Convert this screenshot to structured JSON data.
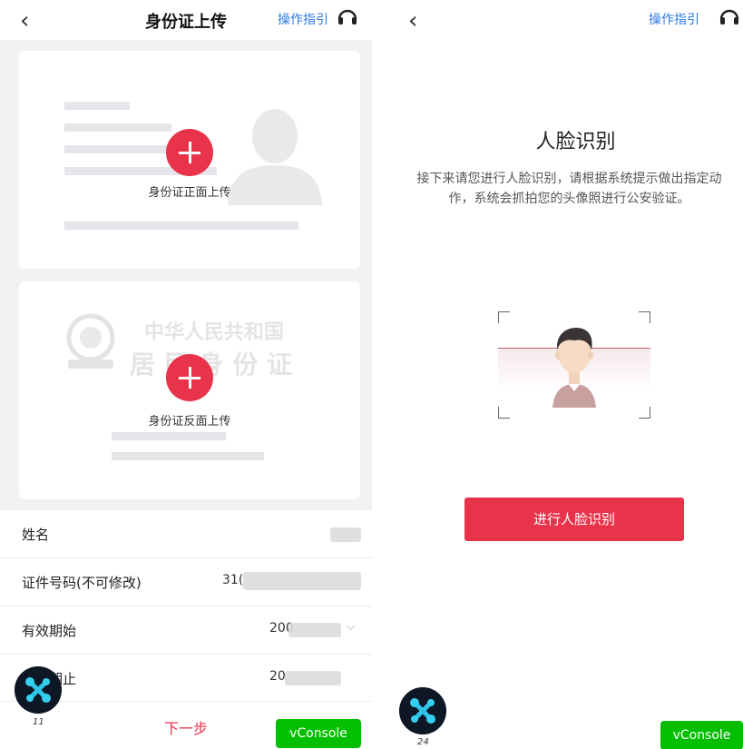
{
  "left": {
    "back_glyph": "‹",
    "title": "身份证上传",
    "guide_link": "操作指引",
    "front_label": "身份证正面上传",
    "back_label": "身份证反面上传",
    "emblem_text_1": "中华人民共和国",
    "emblem_text_2": "居 民 身 份 证",
    "form": [
      {
        "label": "姓名",
        "value": ""
      },
      {
        "label": "证件号码(不可修改)",
        "value": "31("
      },
      {
        "label": "有效期始",
        "value": "200"
      },
      {
        "label": "有效期止",
        "value": "20"
      }
    ],
    "next_button": "下一步",
    "bubble_number": "11",
    "vconsole": "vConsole"
  },
  "right": {
    "back_glyph": "‹",
    "guide_link": "操作指引",
    "title": "人脸识别",
    "description": "接下来请您进行人脸识别，请根据系统提示做出指定动作，系统会抓拍您的头像照进行公安验证。",
    "button": "进行人脸识别",
    "bubble_number": "24",
    "vconsole": "vConsole"
  },
  "colors": {
    "accent": "#e8334a",
    "link": "#2d7be0",
    "vconsole": "#04be02"
  },
  "icons": [
    "back-icon",
    "headset-icon",
    "add-icon",
    "avatar-silhouette-icon",
    "national-emblem-icon",
    "face-avatar-icon",
    "chevron-down-icon",
    "share-bubble-icon"
  ]
}
